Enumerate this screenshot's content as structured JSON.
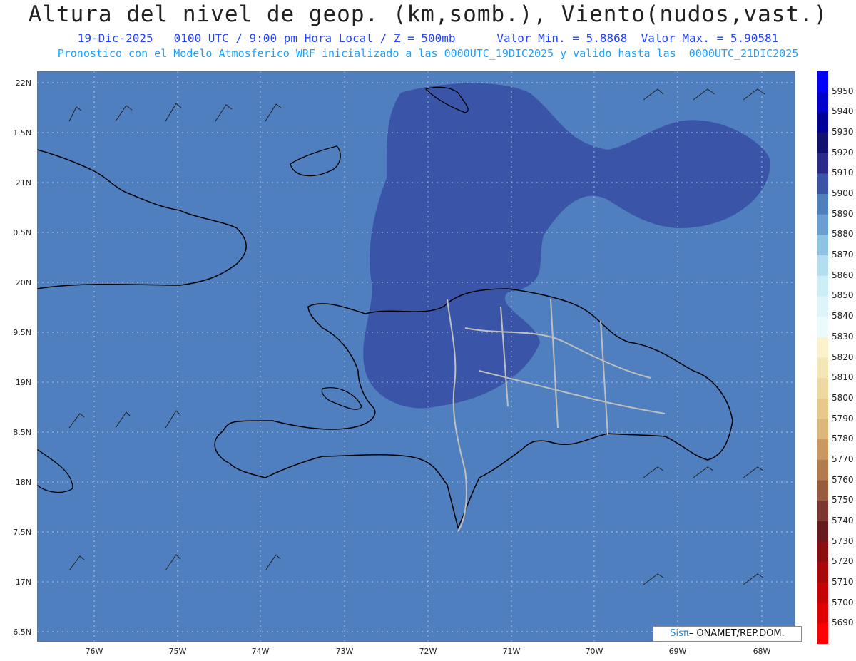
{
  "title": "Altura del nivel de geop. (km,somb.), Viento(nudos,vast.)",
  "subtitle_date": "19-Dic-2025   0100 UTC / 9:00 pm Hora Local / Z = 500mb      Valor Min. = 5.8868  Valor Max. = 5.90581",
  "subtitle_model": "Pronostico con el Modelo Atmosferico WRF inicializado a las 0000UTC_19DIC2025 y valido hasta las  0000UTC_21DIC2025",
  "lat_labels": [
    "22N",
    "1.5N",
    "21N",
    "0.5N",
    "20N",
    "9.5N",
    "19N",
    "8.5N",
    "18N",
    "7.5N",
    "17N",
    "6.5N"
  ],
  "lon_labels": [
    "76W",
    "75W",
    "74W",
    "73W",
    "72W",
    "71W",
    "70W",
    "69W",
    "68W"
  ],
  "colorbar": {
    "levels": [
      "5950",
      "5940",
      "5930",
      "5920",
      "5910",
      "5900",
      "5890",
      "5880",
      "5870",
      "5860",
      "5850",
      "5840",
      "5830",
      "5820",
      "5810",
      "5800",
      "5790",
      "5780",
      "5770",
      "5760",
      "5750",
      "5740",
      "5730",
      "5720",
      "5710",
      "5700",
      "5690"
    ],
    "colors": [
      "#0000ff",
      "#0000cc",
      "#000099",
      "#10106e",
      "#2a2a8c",
      "#3a55a8",
      "#4f7fbf",
      "#6a9fd4",
      "#8fc3e3",
      "#b3deef",
      "#cceef6",
      "#dcf4fa",
      "#eafafd",
      "#fbf2cc",
      "#f5e6b5",
      "#efd9a0",
      "#e8c98a",
      "#ddb77a",
      "#c9975f",
      "#b37a4c",
      "#9a5a3c",
      "#7d3530",
      "#661a1e",
      "#8a0e0e",
      "#a80808",
      "#c40404",
      "#e00000",
      "#ff0000"
    ]
  },
  "credit": {
    "sis": "Sisπ",
    "org": "– ONAMET/REP.DOM."
  },
  "colors": {
    "background_field": "#4f7fbf",
    "high_field": "#3a55a8",
    "grid": "#c8d6ea",
    "borders": "#bfbfbf",
    "coast": "#000000"
  }
}
